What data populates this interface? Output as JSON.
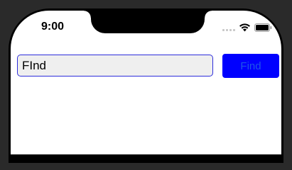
{
  "status_bar": {
    "time": "9:00",
    "icons": [
      "signal-icon",
      "wifi-icon",
      "battery-icon"
    ]
  },
  "search": {
    "value": "FInd",
    "placeholder": ""
  },
  "find_button": {
    "label": "Find"
  },
  "colors": {
    "button_background": "#0000ff",
    "button_text": "#1e56e8",
    "input_border": "#2d2ddb",
    "input_background": "#efefef"
  }
}
